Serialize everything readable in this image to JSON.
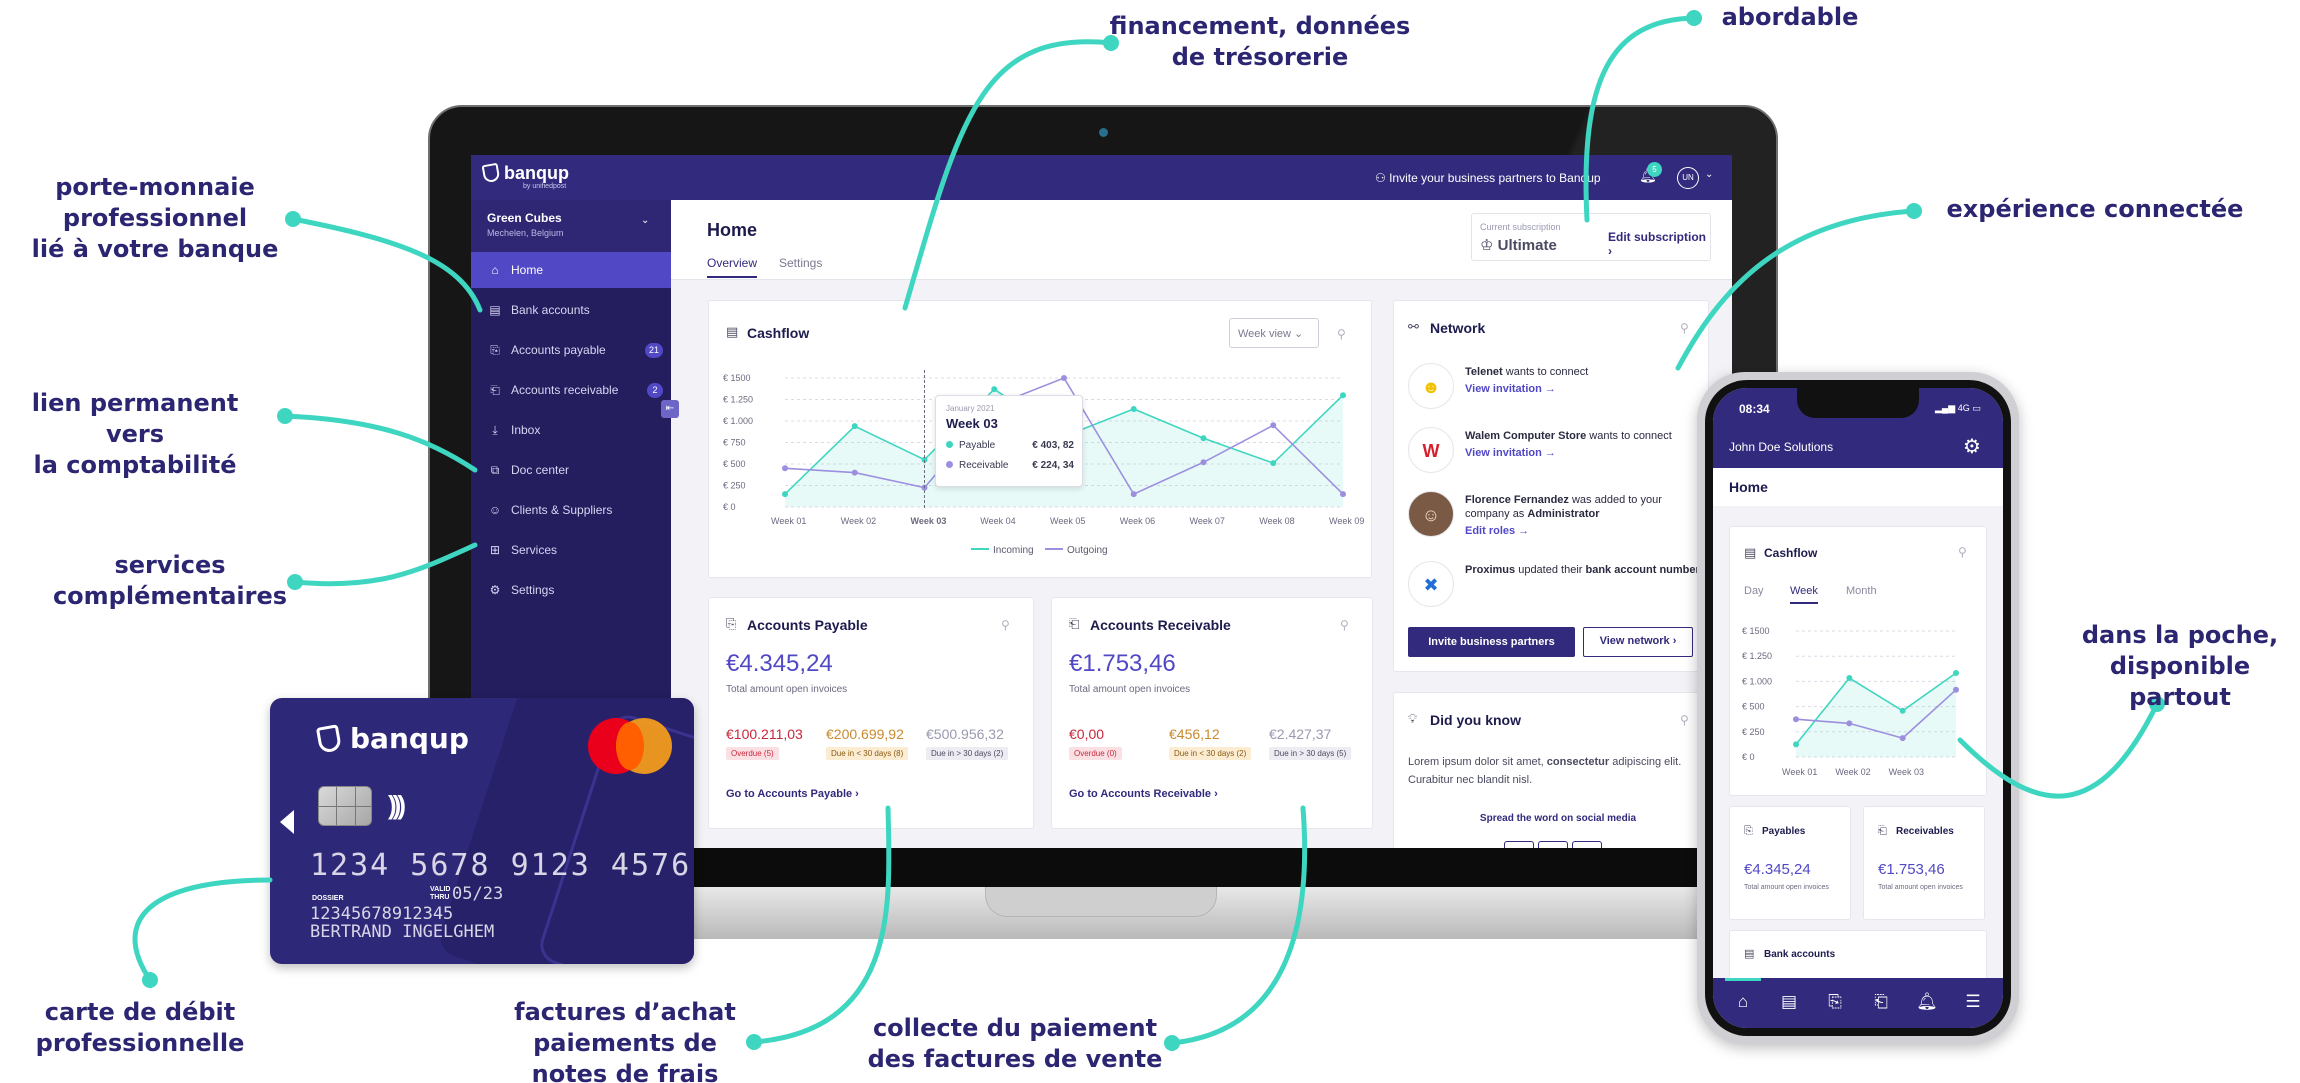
{
  "callouts": {
    "financement": "financement, données\nde trésorerie",
    "abordable": "abordable",
    "porte_monnaie": "porte-monnaie\nprofessionnel\nlié à votre banque",
    "experience": "expérience connectée",
    "lien": "lien permanent vers\nla comptabilité",
    "services": "services\ncomplémentaires",
    "poche": "dans la poche,\ndisponible partout",
    "carte": "carte de débit\nprofessionnelle",
    "factures_achat": "factures d’achat\npaiements de\nnotes de frais",
    "collecte": "collecte du paiement\ndes factures de vente"
  },
  "app": {
    "brand": "banqup",
    "brand_sub": "by unifiedpost",
    "invite_partners": "Invite your business partners to Banqup",
    "notification_count": "5",
    "user_initials": "UN",
    "company_name": "Green Cubes",
    "company_location": "Mechelen, Belgium",
    "nav": [
      {
        "label": "Home",
        "icon": "home-icon",
        "glyph": "⌂",
        "badge": ""
      },
      {
        "label": "Bank accounts",
        "icon": "bank-icon",
        "glyph": "▤",
        "badge": ""
      },
      {
        "label": "Accounts payable",
        "icon": "payable-doc-icon",
        "glyph": "⎘",
        "badge": "21"
      },
      {
        "label": "Accounts receivable",
        "icon": "receivable-doc-icon",
        "glyph": "⎗",
        "badge": "2"
      },
      {
        "label": "Inbox",
        "icon": "inbox-icon",
        "glyph": "⤓",
        "badge": ""
      },
      {
        "label": "Doc center",
        "icon": "doc-center-icon",
        "glyph": "⧉",
        "badge": ""
      },
      {
        "label": "Clients & Suppliers",
        "icon": "clients-icon",
        "glyph": "☺",
        "badge": ""
      },
      {
        "label": "Services",
        "icon": "services-icon",
        "glyph": "⊞",
        "badge": ""
      },
      {
        "label": "Settings",
        "icon": "settings-icon",
        "glyph": "⚙",
        "badge": ""
      }
    ],
    "page_title": "Home",
    "tabs": [
      "Overview",
      "Settings"
    ],
    "subscription_label": "Current subscription",
    "subscription_value": "Ultimate",
    "edit_subscription": "Edit subscription",
    "cashflow_title": "Cashflow",
    "week_view": "Week view",
    "tooltip": {
      "date": "January 2021",
      "week": "Week 03",
      "payable_label": "Payable",
      "payable_value": "€ 403, 82",
      "receivable_label": "Receivable",
      "receivable_value": "€ 224, 34"
    },
    "legend_incoming": "Incoming",
    "legend_outgoing": "Outgoing",
    "payable": {
      "title": "Accounts Payable",
      "amount": "€4.345,24",
      "sub": "Total amount open invoices",
      "splits": [
        {
          "value": "€100.211,03",
          "badge": "Overdue (5)",
          "color": "#c8283c",
          "badge_bg": "#fbe0e3"
        },
        {
          "value": "€200.699,92",
          "badge": "Due in < 30 days (8)",
          "color": "#c98a2e",
          "badge_bg": "#fbecd2"
        },
        {
          "value": "€500.956,32",
          "badge": "Due in > 30 days (2)",
          "color": "#9a9ab0",
          "badge_bg": "#ececf2"
        }
      ],
      "link": "Go to Accounts Payable"
    },
    "receivable": {
      "title": "Accounts Receivable",
      "amount": "€1.753,46",
      "sub": "Total amount open invoices",
      "splits": [
        {
          "value": "€0,00",
          "badge": "Overdue (0)",
          "color": "#c8283c",
          "badge_bg": "#fbe0e3"
        },
        {
          "value": "€456,12",
          "badge": "Due in < 30 days (2)",
          "color": "#c98a2e",
          "badge_bg": "#fbecd2"
        },
        {
          "value": "€2.427,37",
          "badge": "Due in > 30 days (5)",
          "color": "#9a9ab0",
          "badge_bg": "#ececf2"
        }
      ],
      "link": "Go to Accounts Receivable"
    },
    "network": {
      "title": "Network",
      "items": [
        {
          "name": "Telenet",
          "text": "wants to connect",
          "link": "View invitation"
        },
        {
          "name": "Walem Computer Store",
          "text": "wants to connect",
          "link": "View invitation"
        },
        {
          "name": "Florence Fernandez",
          "text": "was added to your company as",
          "role": "Administrator",
          "link": "Edit roles"
        },
        {
          "name": "Proximus",
          "text": "updated their",
          "extra": "bank account number",
          "link": ""
        }
      ],
      "invite_btn": "Invite business partners",
      "view_btn": "View network"
    },
    "did_you_know": {
      "title": "Did you know",
      "text_a": "Lorem ipsum dolor sit amet,",
      "text_b": "consectetur",
      "text_c": "adipiscing elit. Curabitur nec blandit nisl.",
      "spread": "Spread the word on social media"
    }
  },
  "chart_data": {
    "type": "line",
    "categories": [
      "Week 01",
      "Week 02",
      "Week 03",
      "Week 04",
      "Week 05",
      "Week 06",
      "Week 07",
      "Week 08",
      "Week 09"
    ],
    "series": [
      {
        "name": "Incoming",
        "color": "#3ed6c0",
        "values": [
          150,
          940,
          550,
          1370,
          820,
          1140,
          800,
          510,
          1300
        ]
      },
      {
        "name": "Outgoing",
        "color": "#9c8fe0",
        "values": [
          450,
          400,
          225,
          1180,
          1500,
          150,
          520,
          950,
          150
        ]
      }
    ],
    "y_ticks": [
      "€ 0",
      "€ 250",
      "€ 500",
      "€ 750",
      "€ 1.000",
      "€ 1.250",
      "€ 1500"
    ],
    "ylim": [
      0,
      1500
    ],
    "highlight": "Week 03",
    "grid": true,
    "legend": "bottom"
  },
  "debit_card": {
    "brand": "banqup",
    "number": "1234  5678  9123  4576",
    "valid_label": "VALID\nTHRU",
    "valid": "05/23",
    "dossier_label": "DOSSIER",
    "dossier": "12345678912345",
    "holder": "BERTRAND INGELGHEM"
  },
  "phone": {
    "time": "08:34",
    "status": "4G",
    "company": "John Doe Solutions",
    "home": "Home",
    "cashflow_title": "Cashflow",
    "tabs": [
      "Day",
      "Week",
      "Month"
    ],
    "chart_data": {
      "type": "line",
      "categories": [
        "Week 01",
        "Week 02",
        "Week 03"
      ],
      "y_ticks": [
        "€ 0",
        "€ 250",
        "€ 500",
        "€ 1.000",
        "€ 1.250",
        "€ 1500"
      ],
      "series": [
        {
          "name": "Incoming",
          "color": "#3ed6c0",
          "values": [
            150,
            940,
            550,
            1000
          ]
        },
        {
          "name": "Outgoing",
          "color": "#9c8fe0",
          "values": [
            450,
            400,
            225,
            800
          ]
        }
      ]
    },
    "payables": {
      "title": "Payables",
      "amount": "€4.345,24",
      "sub": "Total amount open invoices"
    },
    "receivables": {
      "title": "Receivables",
      "amount": "€1.753,46",
      "sub": "Total amount open invoices"
    },
    "bank_accounts": "Bank accounts"
  }
}
